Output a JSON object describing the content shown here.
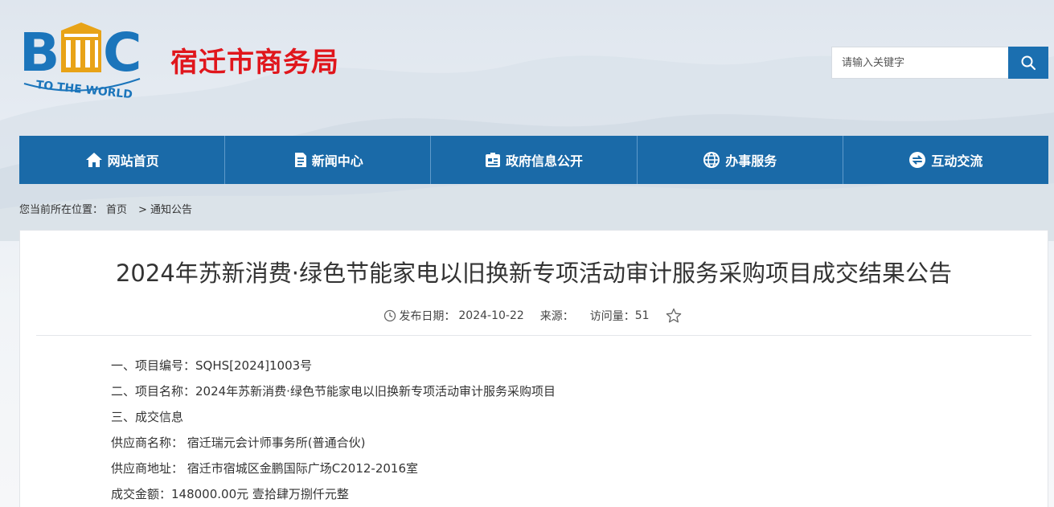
{
  "site": {
    "logo_text": "BMC",
    "logo_tagline": "TO THE WORLD",
    "title": "宿迁市商务局"
  },
  "search": {
    "placeholder": "请输入关键字"
  },
  "nav": {
    "items": [
      {
        "label": "网站首页",
        "icon": "home-icon"
      },
      {
        "label": "新闻中心",
        "icon": "news-icon"
      },
      {
        "label": "政府信息公开",
        "icon": "gov-info-icon"
      },
      {
        "label": "办事服务",
        "icon": "globe-icon"
      },
      {
        "label": "互动交流",
        "icon": "exchange-icon"
      }
    ]
  },
  "breadcrumb": {
    "prefix": "您当前所在位置：",
    "items": [
      "首页",
      "通知公告"
    ],
    "separator": ">"
  },
  "article": {
    "title": "2024年苏新消费·绿色节能家电以旧换新专项活动审计服务采购项目成交结果公告",
    "publish_label": "发布日期：",
    "publish_date": "2024-10-22",
    "source_label": "来源：",
    "views_label": "访问量：",
    "views": "51",
    "lines": [
      "一、项目编号：SQHS[2024]1003号",
      "二、项目名称：2024年苏新消费·绿色节能家电以旧换新专项活动审计服务采购项目",
      "三、成交信息",
      "供应商名称：   宿迁瑞元会计师事务所(普通合伙)",
      "供应商地址：   宿迁市宿城区金鹏国际广场C2012-2016室",
      "成交金额：148000.00元     壹拾肆万捌仟元整"
    ]
  },
  "colors": {
    "nav_bg": "#1a6aa8",
    "title_red": "#e0161c",
    "logo_blue": "#1b75bb",
    "logo_gold": "#e8a317"
  }
}
